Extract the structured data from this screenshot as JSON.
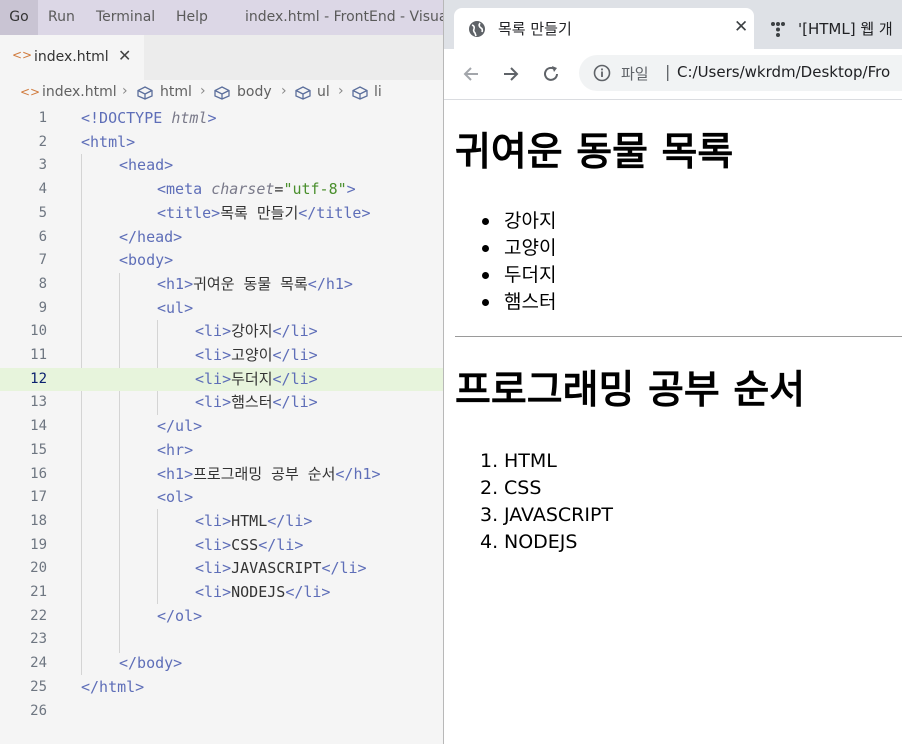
{
  "vscode": {
    "menu": [
      "Go",
      "Run",
      "Terminal",
      "Help"
    ],
    "window_title": "index.html - FrontEnd - Visual",
    "tab": {
      "filename": "index.html",
      "close": "✕"
    },
    "breadcrumb": [
      "index.html",
      "html",
      "body",
      "ul",
      "li"
    ],
    "highlighted_line": 12,
    "lines": [
      {
        "n": "1",
        "tag": "<!DOCTYPE ",
        "attr": "html",
        "tag2": ">"
      },
      {
        "n": "2",
        "code": "<html>"
      },
      {
        "n": "3",
        "code": "<head>"
      },
      {
        "n": "4",
        "tag": "<meta ",
        "attr": "charset",
        "eq": "=",
        "str": "\"utf-8\"",
        "tag2": ">"
      },
      {
        "n": "5",
        "open": "<title>",
        "text": "목록 만들기",
        "close": "</title>"
      },
      {
        "n": "6",
        "code": "</head>"
      },
      {
        "n": "7",
        "code": "<body>"
      },
      {
        "n": "8",
        "open": "<h1>",
        "text": "귀여운 동물 목록",
        "close": "</h1>"
      },
      {
        "n": "9",
        "code": "<ul>"
      },
      {
        "n": "10",
        "open": "<li>",
        "text": "강아지",
        "close": "</li>"
      },
      {
        "n": "11",
        "open": "<li>",
        "text": "고양이",
        "close": "</li>"
      },
      {
        "n": "12",
        "open": "<li>",
        "text": "두더지",
        "close": "</li>"
      },
      {
        "n": "13",
        "open": "<li>",
        "text": "햄스터",
        "close": "</li>"
      },
      {
        "n": "14",
        "code": "</ul>"
      },
      {
        "n": "15",
        "code": "<hr>"
      },
      {
        "n": "16",
        "open": "<h1>",
        "text": "프로그래밍 공부 순서",
        "close": "</h1>"
      },
      {
        "n": "17",
        "code": "<ol>"
      },
      {
        "n": "18",
        "open": "<li>",
        "text": "HTML",
        "close": "</li>"
      },
      {
        "n": "19",
        "open": "<li>",
        "text": "CSS",
        "close": "</li>"
      },
      {
        "n": "20",
        "open": "<li>",
        "text": "JAVASCRIPT",
        "close": "</li>"
      },
      {
        "n": "21",
        "open": "<li>",
        "text": "NODEJS",
        "close": "</li>"
      },
      {
        "n": "22",
        "code": "</ol>"
      },
      {
        "n": "23",
        "code": ""
      },
      {
        "n": "24",
        "code": "</body>"
      },
      {
        "n": "25",
        "code": "</html>"
      },
      {
        "n": "26",
        "code": ""
      }
    ]
  },
  "browser": {
    "active_tab_title": "목록 만들기",
    "tab_close": "✕",
    "second_tab_title": "'[HTML] 웹 개",
    "address_label": "파일",
    "address_url": "C:/Users/wkrdm/Desktop/Fro",
    "page": {
      "heading1": "귀여운 동물 목록",
      "animals": [
        "강아지",
        "고양이",
        "두더지",
        "햄스터"
      ],
      "heading2": "프로그래밍 공부 순서",
      "ordered": [
        "HTML",
        "CSS",
        "JAVASCRIPT",
        "NODEJS"
      ],
      "ordered_markers": [
        "1.",
        "2.",
        "3.",
        "4."
      ]
    }
  },
  "colors": {
    "tag": "#5e6eb8",
    "string": "#4a8f2d",
    "highlight_line": "#e7f4dc",
    "menubar": "#dcd7e6"
  }
}
